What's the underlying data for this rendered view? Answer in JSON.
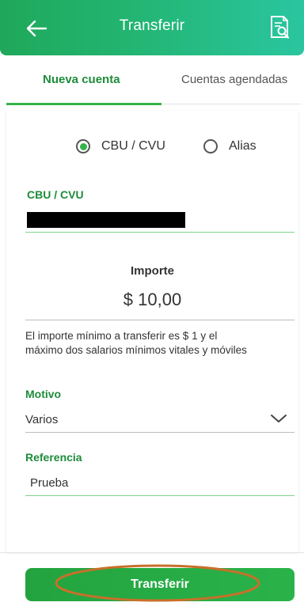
{
  "header": {
    "title": "Transferir",
    "back_icon": "arrow-left-icon",
    "right_icon": "receipt-search-icon",
    "gradient_colors": [
      "#1fa85a",
      "#2ac6a0"
    ]
  },
  "tabs": [
    {
      "label": "Nueva cuenta",
      "active": true
    },
    {
      "label": "Cuentas agendadas",
      "active": false
    }
  ],
  "account_type": {
    "options": [
      {
        "label": "CBU / CVU",
        "selected": true
      },
      {
        "label": "Alias",
        "selected": false
      }
    ]
  },
  "cbu": {
    "label": "CBU / CVU",
    "value_redacted": true
  },
  "amount": {
    "label": "Importe",
    "value": "$ 10,00"
  },
  "hint": {
    "line1": "El importe mínimo a transferir es $ 1 y  el",
    "line2": "máximo dos salarios mínimos vitales y móviles"
  },
  "motivo": {
    "label": "Motivo",
    "value": "Varios",
    "icon": "chevron-down-icon"
  },
  "referencia": {
    "label": "Referencia",
    "value": "Prueba"
  },
  "submit": {
    "label": "Transferir"
  },
  "colors": {
    "accent_green": "#35b34a",
    "label_green": "#1d8c3a",
    "highlight_orange": "#c8702a",
    "text": "#333333"
  }
}
